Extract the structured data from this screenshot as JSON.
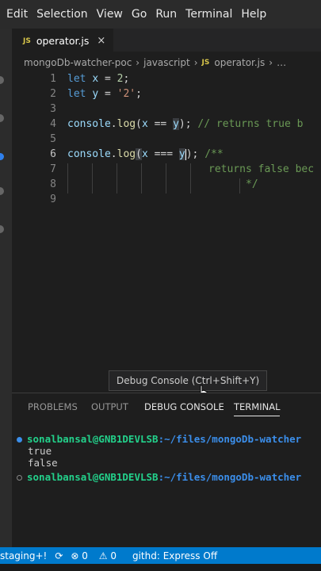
{
  "menu": [
    "Edit",
    "Selection",
    "View",
    "Go",
    "Run",
    "Terminal",
    "Help"
  ],
  "tab": {
    "badge": "JS",
    "name": "operator.js",
    "close": "×"
  },
  "breadcrumb": {
    "folder": "mongoDb-watcher-poc",
    "subfolder": "javascript",
    "badge": "JS",
    "file": "operator.js",
    "more": "…"
  },
  "editor": {
    "line_numbers": [
      "1",
      "2",
      "3",
      "4",
      "5",
      "6",
      "7",
      "8",
      "9"
    ],
    "l1": {
      "kw": "let",
      "var": "x",
      "eq": " = ",
      "num": "2",
      "end": ";"
    },
    "l2": {
      "kw": "let",
      "var": "y",
      "eq": " = ",
      "str": "'2'",
      "end": ";"
    },
    "l4": {
      "obj": "console",
      "dot": ".",
      "fn": "log",
      "open": "(",
      "a": "x",
      "op": " == ",
      "b": "y",
      "close": ");",
      "comment": " // returns true b"
    },
    "l6": {
      "obj": "console",
      "dot": ".",
      "fn": "log",
      "open": "(",
      "a": "x",
      "op": " === ",
      "b": "y",
      "close": ");",
      "comment": " /**"
    },
    "l7": {
      "comment": "returns false bec"
    },
    "l8": {
      "comment": "*/"
    }
  },
  "tooltip": "Debug Console (Ctrl+Shift+Y)",
  "panel": {
    "tabs": [
      "PROBLEMS",
      "OUTPUT",
      "DEBUG CONSOLE",
      "TERMINAL"
    ],
    "terminal": {
      "prompt1": "sonalbansal@GNB1DEVLSB",
      "path1": ":~/files/mongoDb-watcher",
      "out1": "true",
      "out2": "false",
      "prompt2": "sonalbansal@GNB1DEVLSB",
      "path2": ":~/files/mongoDb-watcher"
    }
  },
  "status": {
    "branch": "staging+!",
    "errors": "0",
    "warnings": "0",
    "extension": "githd: Express Off"
  },
  "colors": {
    "accent": "#007acc",
    "prompt": "#23d18b",
    "path": "#3b8eea",
    "badge_js": "#d8c64a"
  }
}
